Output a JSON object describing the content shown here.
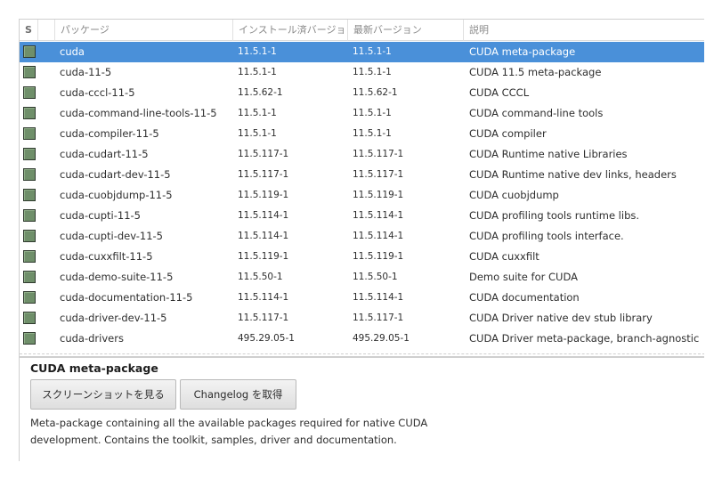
{
  "list": {
    "columns": {
      "status": "S",
      "package": "パッケージ",
      "installed_version": "インストール済バージョン",
      "latest_version": "最新バージョン",
      "description": "説明"
    },
    "rows": [
      {
        "name": "cuda",
        "installed": "11.5.1-1",
        "latest": "11.5.1-1",
        "description": "CUDA meta-package",
        "selected": true
      },
      {
        "name": "cuda-11-5",
        "installed": "11.5.1-1",
        "latest": "11.5.1-1",
        "description": "CUDA 11.5 meta-package"
      },
      {
        "name": "cuda-cccl-11-5",
        "installed": "11.5.62-1",
        "latest": "11.5.62-1",
        "description": "CUDA CCCL"
      },
      {
        "name": "cuda-command-line-tools-11-5",
        "installed": "11.5.1-1",
        "latest": "11.5.1-1",
        "description": "CUDA command-line tools"
      },
      {
        "name": "cuda-compiler-11-5",
        "installed": "11.5.1-1",
        "latest": "11.5.1-1",
        "description": "CUDA compiler"
      },
      {
        "name": "cuda-cudart-11-5",
        "installed": "11.5.117-1",
        "latest": "11.5.117-1",
        "description": "CUDA Runtime native Libraries"
      },
      {
        "name": "cuda-cudart-dev-11-5",
        "installed": "11.5.117-1",
        "latest": "11.5.117-1",
        "description": "CUDA Runtime native dev links, headers"
      },
      {
        "name": "cuda-cuobjdump-11-5",
        "installed": "11.5.119-1",
        "latest": "11.5.119-1",
        "description": "CUDA cuobjdump"
      },
      {
        "name": "cuda-cupti-11-5",
        "installed": "11.5.114-1",
        "latest": "11.5.114-1",
        "description": "CUDA profiling tools runtime libs."
      },
      {
        "name": "cuda-cupti-dev-11-5",
        "installed": "11.5.114-1",
        "latest": "11.5.114-1",
        "description": "CUDA profiling tools interface."
      },
      {
        "name": "cuda-cuxxfilt-11-5",
        "installed": "11.5.119-1",
        "latest": "11.5.119-1",
        "description": "CUDA cuxxfilt"
      },
      {
        "name": "cuda-demo-suite-11-5",
        "installed": "11.5.50-1",
        "latest": "11.5.50-1",
        "description": "Demo suite for CUDA"
      },
      {
        "name": "cuda-documentation-11-5",
        "installed": "11.5.114-1",
        "latest": "11.5.114-1",
        "description": "CUDA documentation"
      },
      {
        "name": "cuda-driver-dev-11-5",
        "installed": "11.5.117-1",
        "latest": "11.5.117-1",
        "description": "CUDA Driver native dev stub library"
      },
      {
        "name": "cuda-drivers",
        "installed": "495.29.05-1",
        "latest": "495.29.05-1",
        "description": "CUDA Driver meta-package, branch-agnostic"
      }
    ]
  },
  "details": {
    "title": "CUDA meta-package",
    "screenshot_button": "スクリーンショットを見る",
    "changelog_button": "Changelog を取得",
    "description": "Meta-package containing all the available packages required for native CUDA development. Contains the toolkit, samples, driver and documentation."
  },
  "colors": {
    "selection": "#4a90d9",
    "installed_checkbox": "#6f8f6a"
  },
  "icons": {
    "row_status": "installed-checkbox-icon"
  }
}
